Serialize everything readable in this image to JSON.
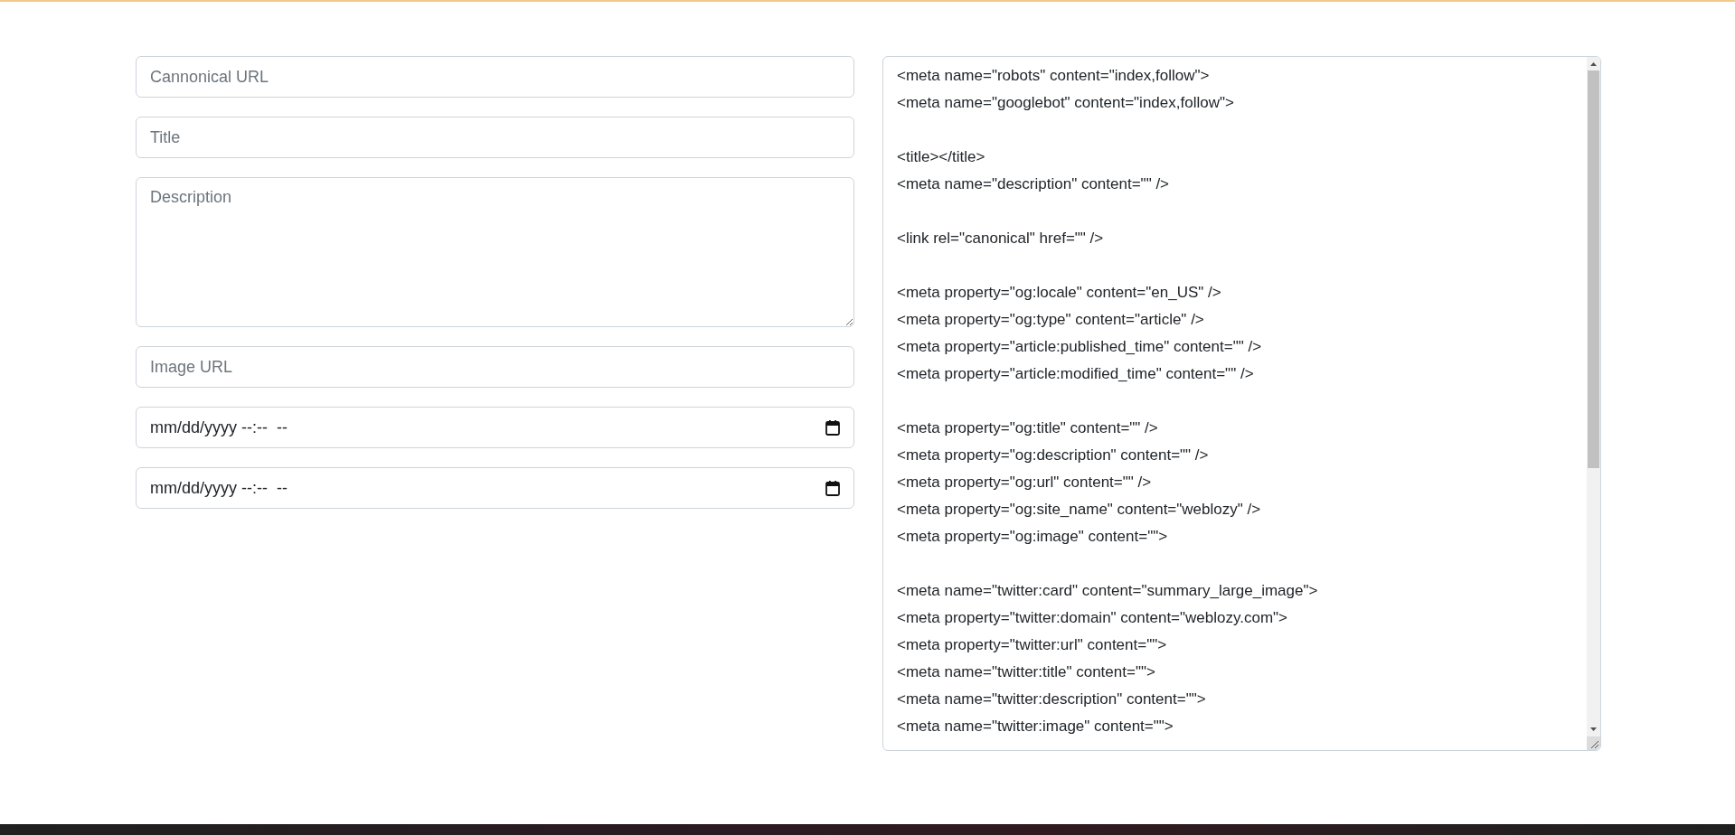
{
  "form": {
    "fields": [
      {
        "kind": "input",
        "placeholder": "Cannonical URL"
      },
      {
        "kind": "input",
        "placeholder": "Title"
      },
      {
        "kind": "textarea",
        "placeholder": "Description"
      },
      {
        "kind": "input",
        "placeholder": "Image URL"
      },
      {
        "kind": "datetime",
        "value": "mm/dd/yyyy --:--  --"
      },
      {
        "kind": "datetime",
        "value": "mm/dd/yyyy --:--  --"
      }
    ]
  },
  "output": {
    "text": "<meta name=\"robots\" content=\"index,follow\">\n<meta name=\"googlebot\" content=\"index,follow\">\n\n<title></title>\n<meta name=\"description\" content=\"\" />\n\n<link rel=\"canonical\" href=\"\" />\n\n<meta property=\"og:locale\" content=\"en_US\" />\n<meta property=\"og:type\" content=\"article\" />\n<meta property=\"article:published_time\" content=\"\" />\n<meta property=\"article:modified_time\" content=\"\" />\n\n<meta property=\"og:title\" content=\"\" />\n<meta property=\"og:description\" content=\"\" />\n<meta property=\"og:url\" content=\"\" />\n<meta property=\"og:site_name\" content=\"weblozy\" />\n<meta property=\"og:image\" content=\"\">\n\n<meta name=\"twitter:card\" content=\"summary_large_image\">\n<meta property=\"twitter:domain\" content=\"weblozy.com\">\n<meta property=\"twitter:url\" content=\"\">\n<meta name=\"twitter:title\" content=\"\">\n<meta name=\"twitter:description\" content=\"\">\n<meta name=\"twitter:image\" content=\"\">"
  }
}
